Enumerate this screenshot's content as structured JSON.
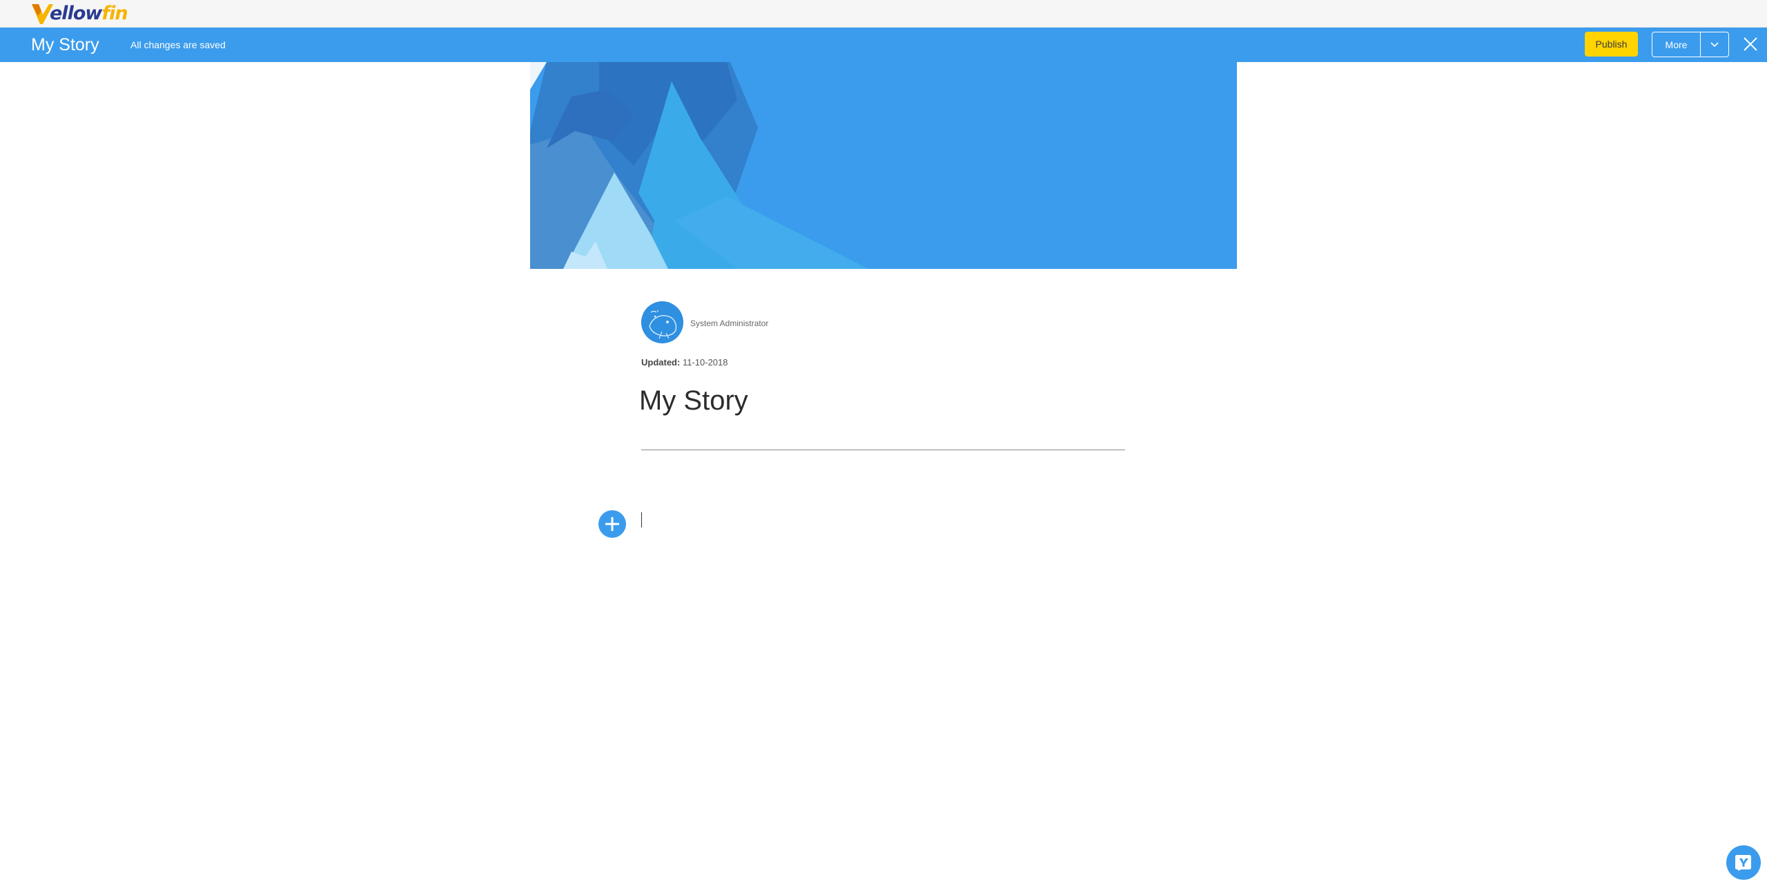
{
  "brand": {
    "logo_lead": "Y",
    "logo_text_a": "ellow",
    "logo_text_b": "fin"
  },
  "story_bar": {
    "title": "My Story",
    "save_status": "All changes are saved",
    "publish_label": "Publish",
    "more_label": "More"
  },
  "author": {
    "name": "System Administrator",
    "updated_label": "Updated:",
    "updated_date": "11-10-2018"
  },
  "story": {
    "heading": "My Story"
  },
  "colors": {
    "accent_blue": "#3b9ced",
    "publish_yellow": "#ffd400"
  },
  "icons": {
    "close": "close-icon",
    "caret": "chevron-down-icon",
    "add": "plus-circle-icon",
    "help": "yellowfin-help-icon"
  }
}
